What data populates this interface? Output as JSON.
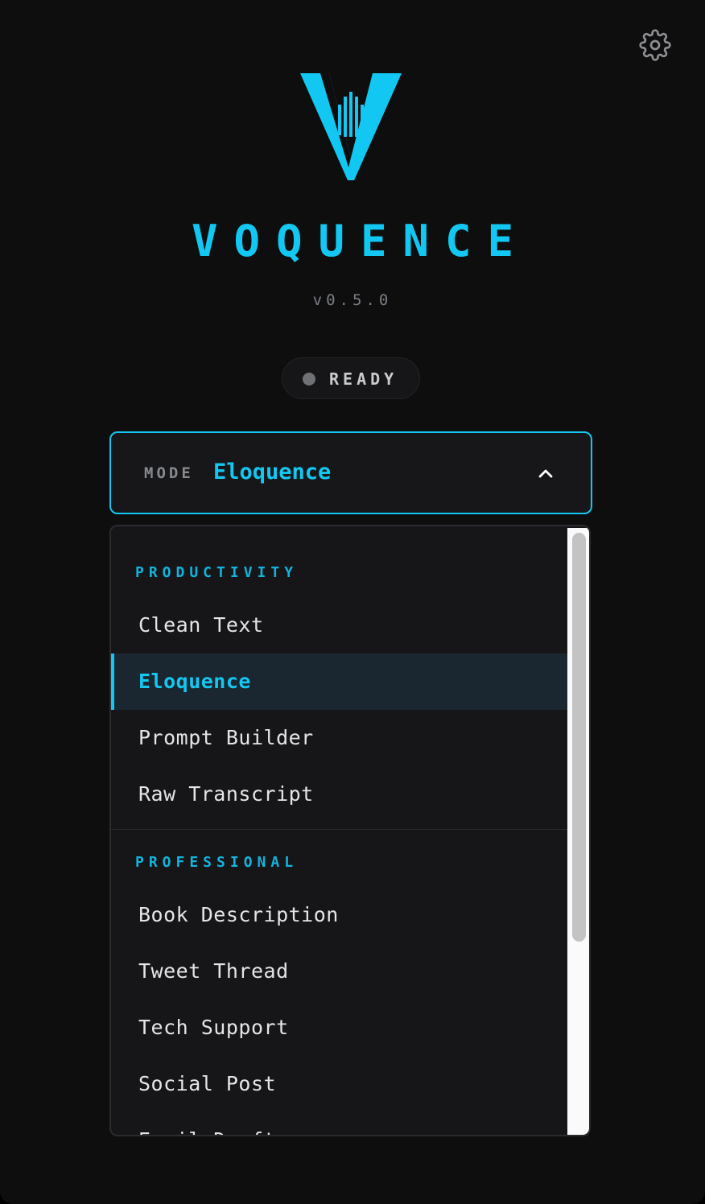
{
  "app": {
    "title": "VOQUENCE",
    "version": "v0.5.0",
    "accent_color": "#12c8f2"
  },
  "header": {
    "settings_icon": "gear-icon"
  },
  "status": {
    "label": "READY",
    "dot_color": "#6f7174"
  },
  "mode_select": {
    "label": "MODE",
    "value": "Eloquence",
    "chevron_icon": "chevron-up-icon",
    "expanded": true
  },
  "dropdown": {
    "groups": [
      {
        "header": "PRODUCTIVITY",
        "items": [
          "Clean Text",
          "Eloquence",
          "Prompt Builder",
          "Raw Transcript"
        ]
      },
      {
        "header": "PROFESSIONAL",
        "items": [
          "Book Description",
          "Tweet Thread",
          "Tech Support",
          "Social Post",
          "Email Draft"
        ]
      }
    ],
    "selected": "Eloquence"
  }
}
